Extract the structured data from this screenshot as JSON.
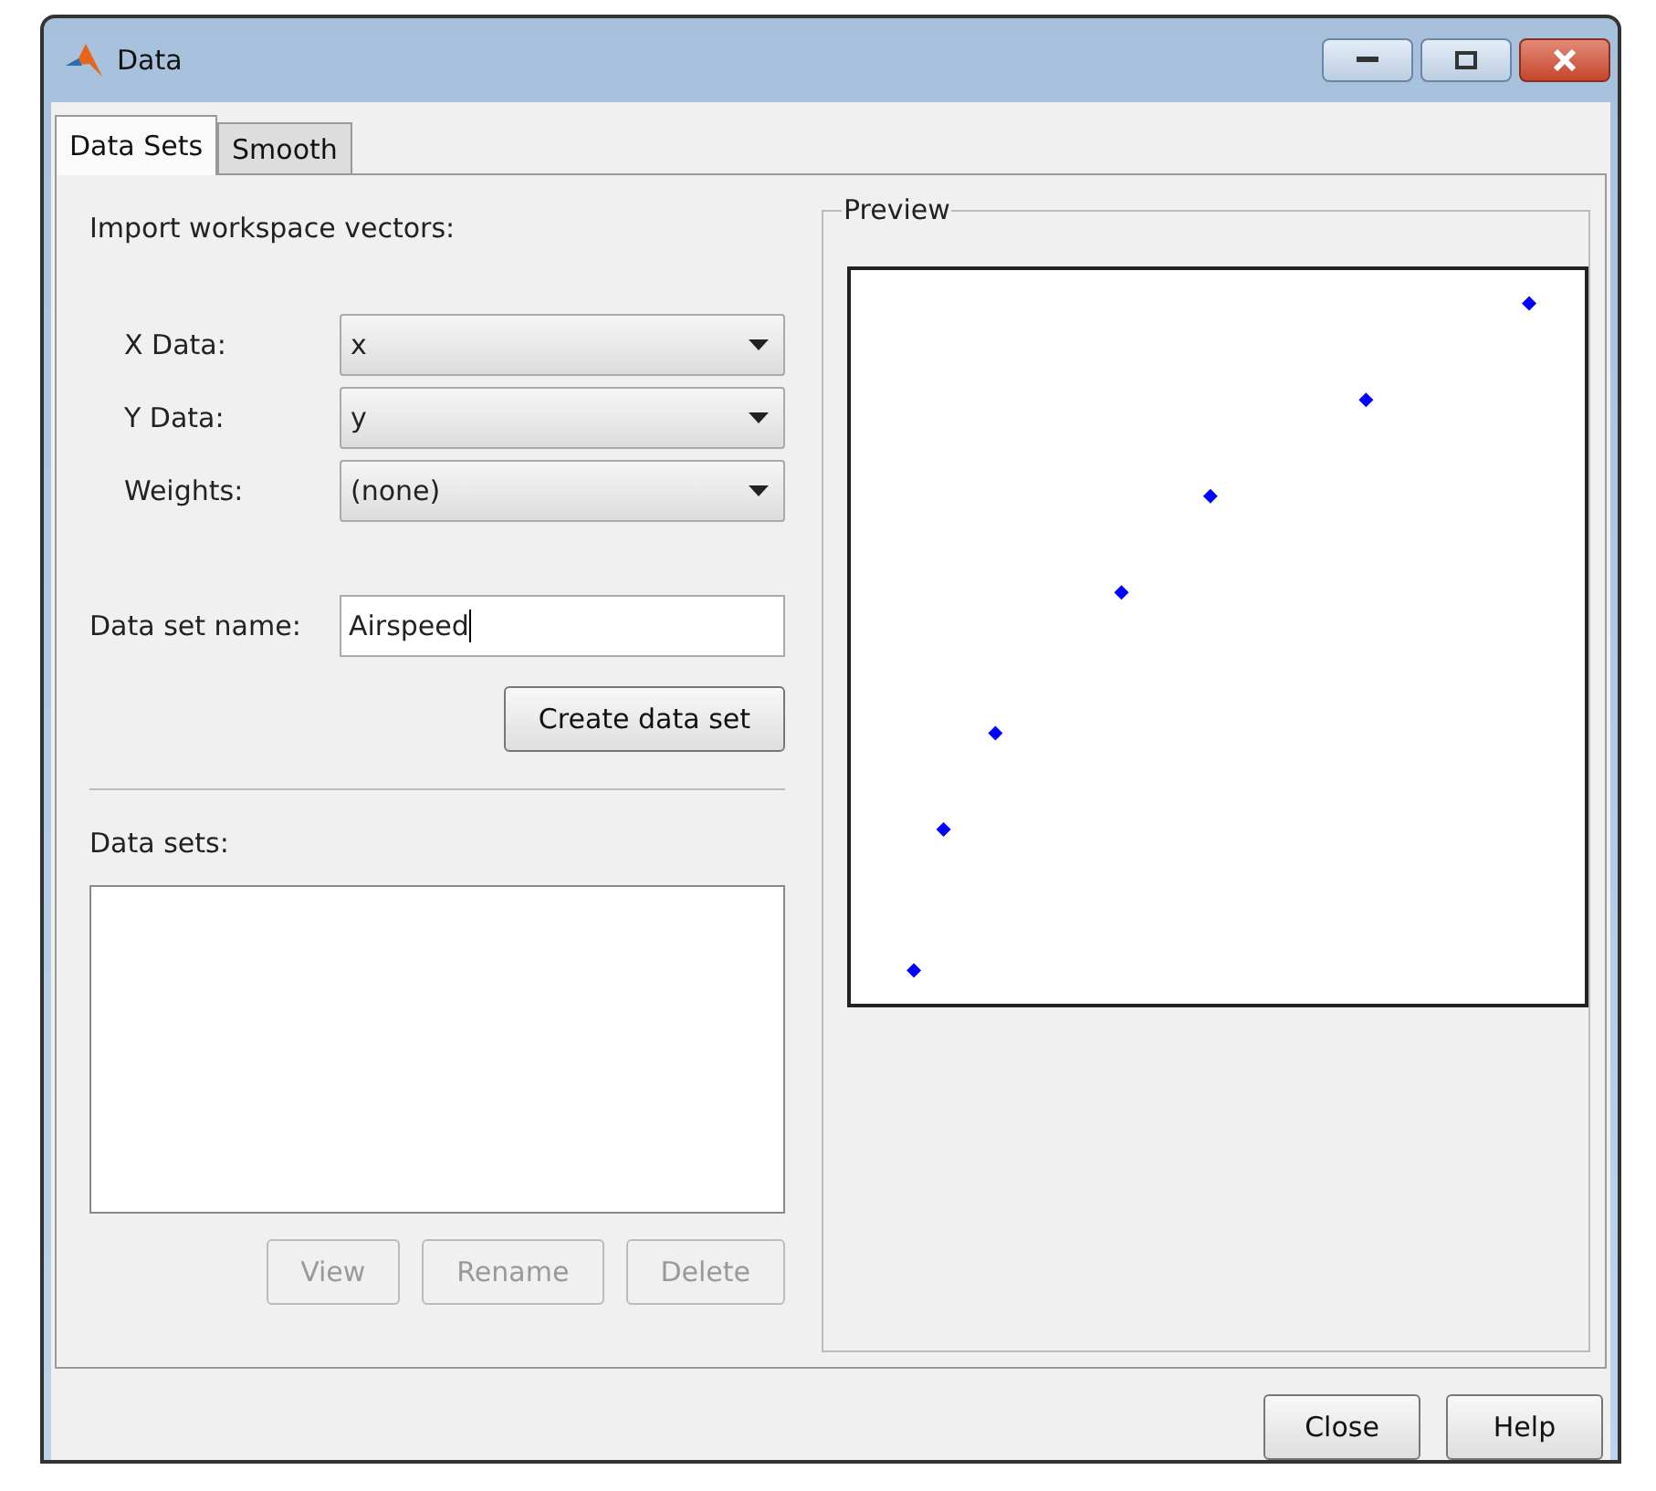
{
  "window": {
    "title": "Data"
  },
  "tabs": [
    {
      "label": "Data Sets",
      "selected": true
    },
    {
      "label": "Smooth",
      "selected": false
    }
  ],
  "import_heading": "Import workspace vectors:",
  "selectors": [
    {
      "label": "X Data:",
      "value": "x"
    },
    {
      "label": "Y Data:",
      "value": "y"
    },
    {
      "label": "Weights:",
      "value": "(none)"
    }
  ],
  "name_field": {
    "label": "Data set name:",
    "value": "Airspeed"
  },
  "create_button": {
    "label": "Create data set",
    "disabled": false
  },
  "data_sets_label": "Data sets:",
  "list_buttons": [
    {
      "label": "View",
      "disabled": true
    },
    {
      "label": "Rename",
      "disabled": true
    },
    {
      "label": "Delete",
      "disabled": true
    }
  ],
  "preview": {
    "title": "Preview"
  },
  "footer_buttons": [
    {
      "label": "Close",
      "disabled": false
    },
    {
      "label": "Help",
      "disabled": false
    }
  ]
}
